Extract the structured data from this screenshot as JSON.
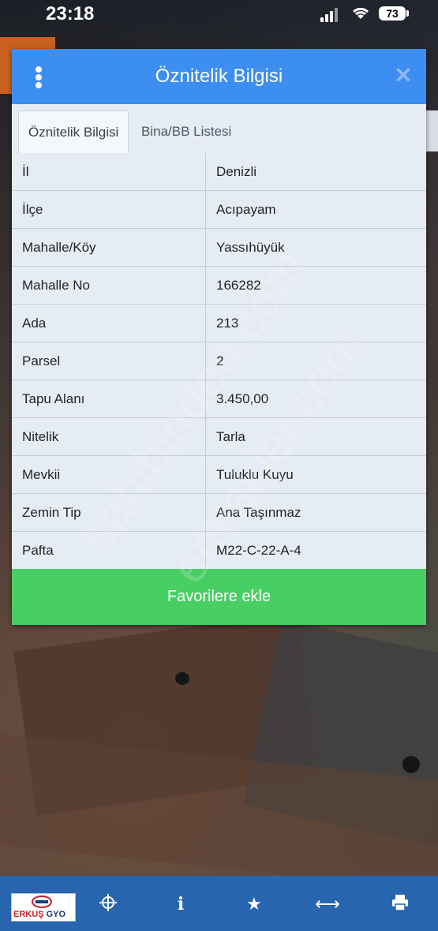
{
  "status_bar": {
    "time": "23:18",
    "battery": "73"
  },
  "dialog": {
    "title": "Öznitelik Bilgisi",
    "tabs": [
      "Öznitelik Bilgisi",
      "Bina/BB Listesi"
    ],
    "rows": [
      {
        "key": "İl",
        "value": "Denizli"
      },
      {
        "key": "İlçe",
        "value": "Acıpayam"
      },
      {
        "key": "Mahalle/Köy",
        "value": "Yassıhüyük"
      },
      {
        "key": "Mahalle No",
        "value": "166282"
      },
      {
        "key": "Ada",
        "value": "213"
      },
      {
        "key": "Parsel",
        "value": "2"
      },
      {
        "key": "Tapu Alanı",
        "value": "3.450,00"
      },
      {
        "key": "Nitelik",
        "value": "Tarla"
      },
      {
        "key": "Mevkii",
        "value": "Tuluklu Kuyu"
      },
      {
        "key": "Zemin Tip",
        "value": "Ana Taşınmaz"
      },
      {
        "key": "Pafta",
        "value": "M22-C-22-A-4"
      }
    ],
    "favorite_button": "Favorilere ekle"
  },
  "watermarks": [
    "sahibinden.com",
    "emlakjet.com"
  ],
  "logo": {
    "brand": "ERKUŞ",
    "suffix": "GYO"
  },
  "bottom_nav": [
    "crosshair-icon",
    "info-icon",
    "star-icon",
    "swap-icon",
    "print-icon"
  ],
  "colors": {
    "header": "#3c8ef0",
    "favorite_button": "#47cf63",
    "bottom_bar": "#2765ae"
  }
}
